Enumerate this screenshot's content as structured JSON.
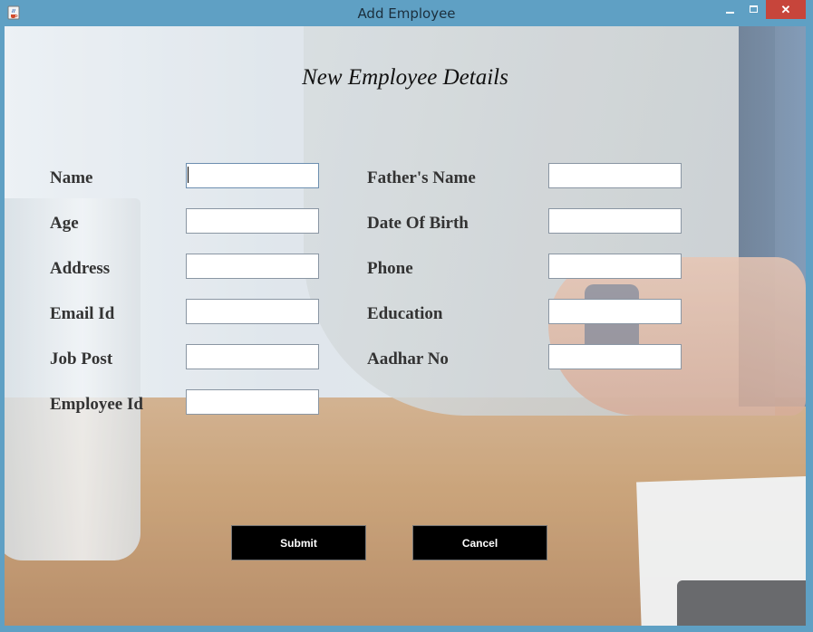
{
  "window": {
    "title": "Add Employee",
    "close_glyph": "✕"
  },
  "form": {
    "heading": "New Employee Details",
    "labels": {
      "name": "Name",
      "fathers_name": "Father's Name",
      "age": "Age",
      "date_of_birth": "Date Of Birth",
      "address": "Address",
      "phone": "Phone",
      "email_id": "Email Id",
      "education": "Education",
      "job_post": "Job Post",
      "aadhar_no": "Aadhar No",
      "employee_id": "Employee Id"
    },
    "values": {
      "name": "",
      "fathers_name": "",
      "age": "",
      "date_of_birth": "",
      "address": "",
      "phone": "",
      "email_id": "",
      "education": "",
      "job_post": "",
      "aadhar_no": "",
      "employee_id": ""
    }
  },
  "buttons": {
    "submit": "Submit",
    "cancel": "Cancel"
  },
  "icons": {
    "app": "java-cup-icon",
    "minimize": "minimize-icon",
    "maximize": "maximize-icon",
    "close": "close-icon"
  }
}
